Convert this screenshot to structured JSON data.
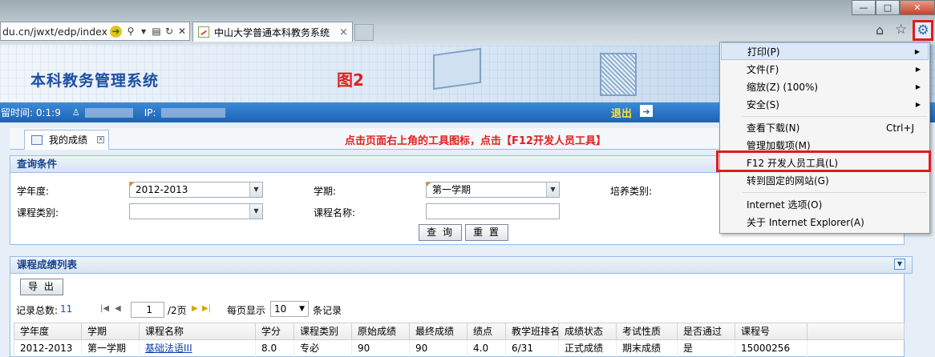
{
  "browser": {
    "address_url": "du.cn/jwxt/edp/index",
    "tab_title": "中山大学普通本科教务系统",
    "tab_close": "×",
    "icons": [
      "back-green-icon",
      "search-icon",
      "dropdown-icon",
      "compat-icon",
      "refresh-icon",
      "stop-icon",
      "home-icon",
      "star-icon",
      "gear-icon"
    ],
    "window_controls": {
      "minimize": "—",
      "maximize": "□",
      "close": "✕"
    }
  },
  "banner": {
    "title": "本科教务管理系统",
    "annotation": "图2"
  },
  "statusbar": {
    "stay_time_label": "留时间: 0:1:9",
    "ip_label": "IP:",
    "logout": "退出"
  },
  "tabs": [
    {
      "label": "我的成绩"
    }
  ],
  "instruction": "点击页面右上角的工具图标，点击【F12开发人员工具】",
  "query_panel": {
    "title": "查询条件",
    "year_label": "学年度:",
    "year_value": "2012-2013",
    "term_label": "学期:",
    "term_value": "第一学期",
    "train_label": "培养类别:",
    "course_type_label": "课程类别:",
    "course_type_value": "",
    "course_name_label": "课程名称:",
    "query_btn": "查 询",
    "reset_btn": "重 置"
  },
  "grid_panel": {
    "title": "课程成绩列表",
    "export_btn": "导 出",
    "total_label": "记录总数:",
    "total_value": "11",
    "page_input": "1",
    "page_total": "/2页",
    "per_page_label": "每页显示",
    "per_page_value": "10",
    "records_label": "条记录",
    "columns": [
      "学年度",
      "学期",
      "课程名称",
      "学分",
      "课程类别",
      "原始成绩",
      "最终成绩",
      "绩点",
      "教学班排名",
      "成绩状态",
      "考试性质",
      "是否通过",
      "课程号"
    ],
    "rows": [
      [
        "2012-2013",
        "第一学期",
        "基础法语III",
        "8.0",
        "专必",
        "90",
        "90",
        "4.0",
        "6/31",
        "正式成绩",
        "期末成绩",
        "是",
        "15000256"
      ]
    ]
  },
  "tools_menu": {
    "items": [
      {
        "label": "打印(P)",
        "submenu": true
      },
      {
        "label": "文件(F)",
        "submenu": true
      },
      {
        "label": "缩放(Z) (100%)",
        "submenu": true
      },
      {
        "label": "安全(S)",
        "submenu": true
      },
      {
        "label": "查看下载(N)",
        "shortcut": "Ctrl+J"
      },
      {
        "label": "管理加载项(M)"
      },
      {
        "label": "F12 开发人员工具(L)"
      },
      {
        "label": "转到固定的网站(G)"
      },
      {
        "label": "Internet 选项(O)"
      },
      {
        "label": "关于 Internet Explorer(A)"
      }
    ]
  }
}
